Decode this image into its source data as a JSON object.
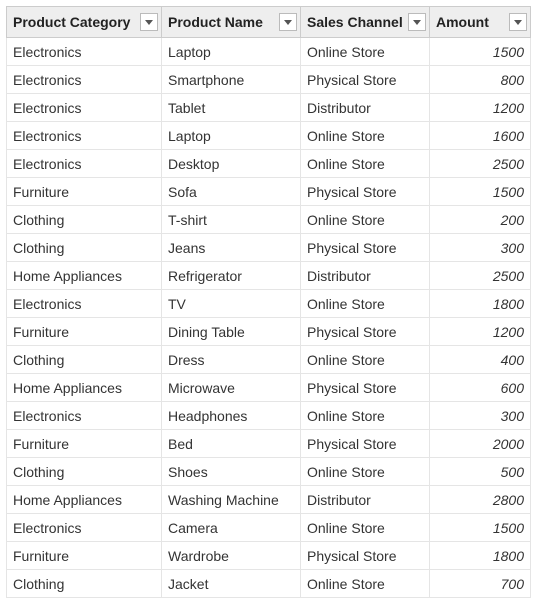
{
  "table": {
    "columns": [
      {
        "key": "category",
        "label": "Product Category",
        "align": "left"
      },
      {
        "key": "name",
        "label": "Product Name",
        "align": "left"
      },
      {
        "key": "channel",
        "label": "Sales Channel",
        "align": "left"
      },
      {
        "key": "amount",
        "label": "Amount",
        "align": "right"
      }
    ],
    "rows": [
      {
        "category": "Electronics",
        "name": "Laptop",
        "channel": "Online Store",
        "amount": "1500"
      },
      {
        "category": "Electronics",
        "name": "Smartphone",
        "channel": "Physical Store",
        "amount": "800"
      },
      {
        "category": "Electronics",
        "name": "Tablet",
        "channel": "Distributor",
        "amount": "1200"
      },
      {
        "category": "Electronics",
        "name": "Laptop",
        "channel": "Online Store",
        "amount": "1600"
      },
      {
        "category": "Electronics",
        "name": "Desktop",
        "channel": "Online Store",
        "amount": "2500"
      },
      {
        "category": "Furniture",
        "name": "Sofa",
        "channel": "Physical Store",
        "amount": "1500"
      },
      {
        "category": "Clothing",
        "name": "T-shirt",
        "channel": "Online Store",
        "amount": "200"
      },
      {
        "category": "Clothing",
        "name": "Jeans",
        "channel": "Physical Store",
        "amount": "300"
      },
      {
        "category": "Home Appliances",
        "name": "Refrigerator",
        "channel": "Distributor",
        "amount": "2500"
      },
      {
        "category": "Electronics",
        "name": "TV",
        "channel": "Online Store",
        "amount": "1800"
      },
      {
        "category": "Furniture",
        "name": "Dining Table",
        "channel": "Physical Store",
        "amount": "1200"
      },
      {
        "category": "Clothing",
        "name": "Dress",
        "channel": "Online Store",
        "amount": "400"
      },
      {
        "category": "Home Appliances",
        "name": "Microwave",
        "channel": "Physical Store",
        "amount": "600"
      },
      {
        "category": "Electronics",
        "name": "Headphones",
        "channel": "Online Store",
        "amount": "300"
      },
      {
        "category": "Furniture",
        "name": "Bed",
        "channel": "Physical Store",
        "amount": "2000"
      },
      {
        "category": "Clothing",
        "name": "Shoes",
        "channel": "Online Store",
        "amount": "500"
      },
      {
        "category": "Home Appliances",
        "name": "Washing Machine",
        "channel": "Distributor",
        "amount": "2800"
      },
      {
        "category": "Electronics",
        "name": "Camera",
        "channel": "Online Store",
        "amount": "1500"
      },
      {
        "category": "Furniture",
        "name": "Wardrobe",
        "channel": "Physical Store",
        "amount": "1800"
      },
      {
        "category": "Clothing",
        "name": "Jacket",
        "channel": "Online Store",
        "amount": "700"
      }
    ]
  }
}
